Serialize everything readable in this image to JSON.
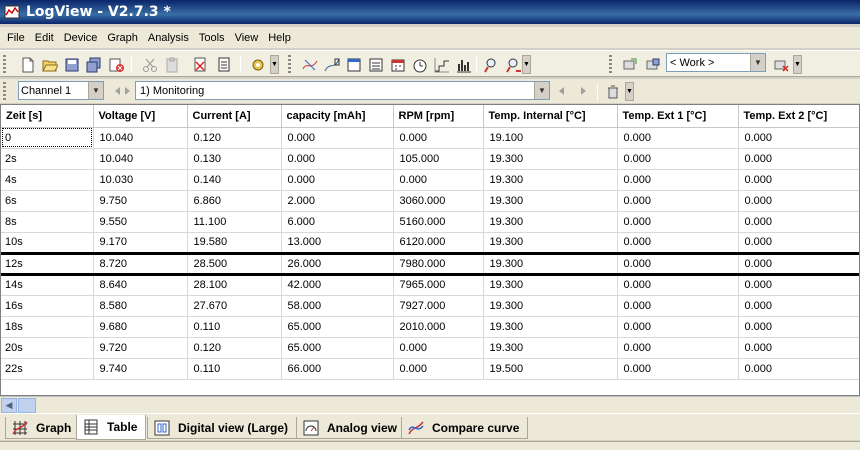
{
  "window": {
    "title": "LogView - V2.7.3 *"
  },
  "menu": [
    "File",
    "Edit",
    "Device",
    "Graph",
    "Analysis",
    "Tools",
    "View",
    "Help"
  ],
  "toolbar": {
    "work_value": "< Work >"
  },
  "channel": {
    "selected": "Channel 1",
    "mode": "1) Monitoring"
  },
  "table": {
    "headers": [
      "Zeit [s]",
      "Voltage [V]",
      "Current [A]",
      "capacity [mAh]",
      "RPM [rpm]",
      "Temp. Internal [°C]",
      "Temp. Ext 1 [°C]",
      "Temp. Ext 2 [°C]"
    ],
    "rows": [
      [
        "0",
        "10.040",
        " 0.120",
        " 0.000",
        "   0.000",
        "19.100",
        "0.000",
        "0.000"
      ],
      [
        "2s",
        "10.040",
        " 0.130",
        " 0.000",
        "105.000",
        "19.300",
        "0.000",
        "0.000"
      ],
      [
        "4s",
        "10.030",
        " 0.140",
        " 0.000",
        "   0.000",
        "19.300",
        "0.000",
        "0.000"
      ],
      [
        "6s",
        " 9.750",
        " 6.860",
        " 2.000",
        "3060.000",
        "19.300",
        "0.000",
        "0.000"
      ],
      [
        "8s",
        " 9.550",
        "11.100",
        " 6.000",
        "5160.000",
        "19.300",
        "0.000",
        "0.000"
      ],
      [
        "10s",
        " 9.170",
        "19.580",
        "13.000",
        "6120.000",
        "19.300",
        "0.000",
        "0.000"
      ],
      [
        "12s",
        " 8.720",
        "28.500",
        "26.000",
        "7980.000",
        "19.300",
        "0.000",
        "0.000"
      ],
      [
        "14s",
        " 8.640",
        "28.100",
        "42.000",
        "7965.000",
        "19.300",
        "0.000",
        "0.000"
      ],
      [
        "16s",
        " 8.580",
        "27.670",
        "58.000",
        "7927.000",
        "19.300",
        "0.000",
        "0.000"
      ],
      [
        "18s",
        " 9.680",
        " 0.110",
        "65.000",
        "2010.000",
        "19.300",
        "0.000",
        "0.000"
      ],
      [
        "20s",
        " 9.720",
        " 0.120",
        "65.000",
        "   0.000",
        "19.300",
        "0.000",
        "0.000"
      ],
      [
        "22s",
        " 9.740",
        " 0.110",
        "66.000",
        "   0.000",
        "19.500",
        "0.000",
        "0.000"
      ]
    ],
    "selected_row": 6
  },
  "tabs": [
    {
      "label": "Graph",
      "icon": "graph-grid-icon",
      "active": false
    },
    {
      "label": "Table",
      "icon": "table-icon",
      "active": true
    },
    {
      "label": "Digital view (Large)",
      "icon": "digital-view-icon",
      "active": false
    },
    {
      "label": "Analog view",
      "icon": "analog-view-icon",
      "active": false
    },
    {
      "label": "Compare curve",
      "icon": "compare-curve-icon",
      "active": false
    }
  ],
  "colors": {
    "title_bar": "#0a246a",
    "selection_border": "#000000",
    "face": "#ece9d8"
  }
}
